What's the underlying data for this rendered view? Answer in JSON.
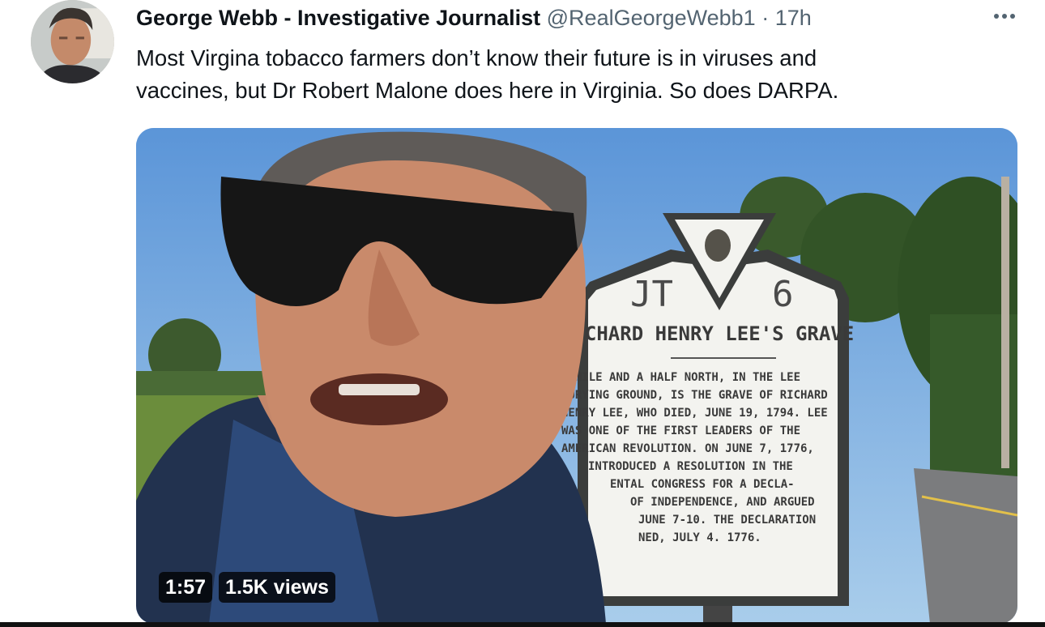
{
  "tweet": {
    "display_name": "George Webb - Investigative Journalist",
    "handle": "@RealGeorgeWebb1",
    "separator": "·",
    "time": "17h",
    "more_icon": "more-horizontal-icon",
    "text_lines": [
      "Most Virgina tobacco farmers don’t know their future is in viruses and",
      "vaccines, but Dr Robert Malone does here in Virginia. So does DARPA."
    ]
  },
  "video": {
    "duration": "1:57",
    "views": "1.5K views"
  },
  "marker_sign": {
    "code_left": "JT",
    "code_right": "6",
    "title": "RICHARD HENRY LEE'S GRAVE",
    "lines": [
      "A MILE AND A HALF NORTH, IN THE LEE",
      "BURYING GROUND, IS THE GRAVE OF RICHARD",
      "HENRY LEE, WHO DIED, JUNE 19, 1794.  LEE",
      "WAS ONE OF THE FIRST  LEADERS OF THE",
      "AMERICAN REVOLUTION. ON JUNE 7, 1776,",
      "INTRODUCED A RESOLUTION IN THE",
      "ENTAL CONGRESS FOR A DECLA-",
      "OF INDEPENDENCE, AND ARGUED",
      "JUNE 7-10. THE  DECLARATION",
      "NED, JULY 4. 1776."
    ]
  },
  "colors": {
    "text_primary": "#0f1419",
    "text_secondary": "#536471",
    "sky": "#6fa3dd"
  }
}
